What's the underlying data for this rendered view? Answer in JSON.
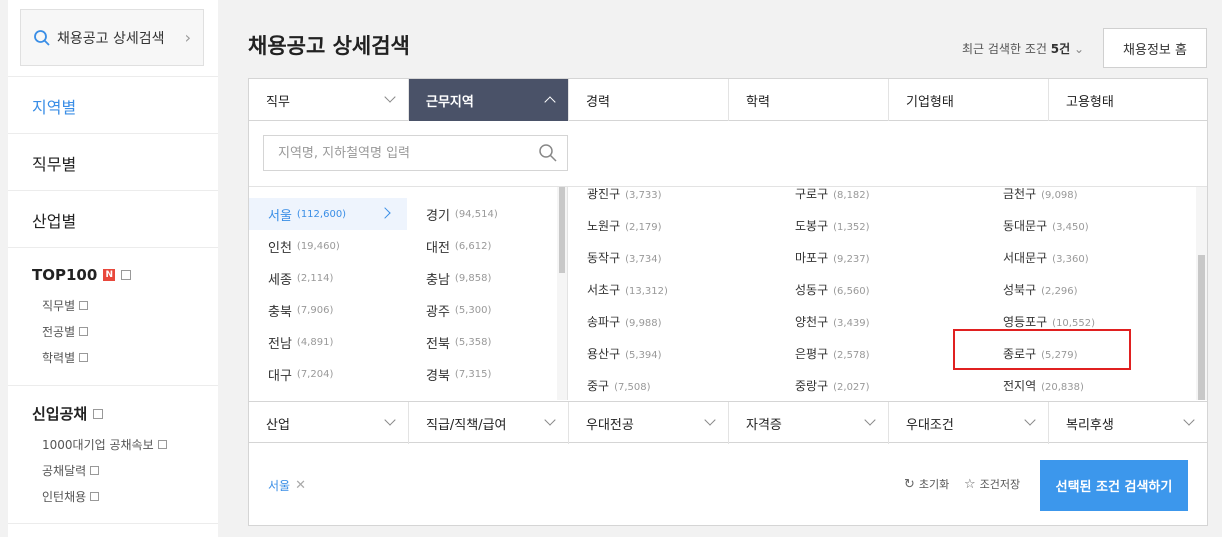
{
  "sidebar": {
    "search_label": "채용공고 상세검색",
    "menus": [
      "지역별",
      "직무별",
      "산업별"
    ],
    "top100": {
      "title": "TOP100",
      "badge": "N",
      "subs": [
        "직무별",
        "전공별",
        "학력별"
      ]
    },
    "newgrad": {
      "title": "신입공채",
      "subs": [
        "1000대기업 공채속보",
        "공채달력",
        "인턴채용"
      ]
    }
  },
  "header": {
    "title": "채용공고 상세검색",
    "recent_prefix": "최근 검색한 조건",
    "recent_count": "5건",
    "home_button": "채용정보 홈"
  },
  "tabs_top": [
    {
      "label": "직무",
      "active": false,
      "arrow": true
    },
    {
      "label": "근무지역",
      "active": true,
      "arrow": true
    },
    {
      "label": "경력",
      "active": false,
      "arrow": false
    },
    {
      "label": "학력",
      "active": false,
      "arrow": false
    },
    {
      "label": "기업형태",
      "active": false,
      "arrow": false
    },
    {
      "label": "고용형태",
      "active": false,
      "arrow": false
    }
  ],
  "region_search": {
    "placeholder": "지역명, 지하철역명 입력"
  },
  "cities_col1": [
    {
      "name": "서울",
      "count": "(112,600)",
      "selected": true
    },
    {
      "name": "인천",
      "count": "(19,460)",
      "selected": false
    },
    {
      "name": "세종",
      "count": "(2,114)",
      "selected": false
    },
    {
      "name": "충북",
      "count": "(7,906)",
      "selected": false
    },
    {
      "name": "전남",
      "count": "(4,891)",
      "selected": false
    },
    {
      "name": "대구",
      "count": "(7,204)",
      "selected": false
    }
  ],
  "cities_col2": [
    {
      "name": "경기",
      "count": "(94,514)"
    },
    {
      "name": "대전",
      "count": "(6,612)"
    },
    {
      "name": "충남",
      "count": "(9,858)"
    },
    {
      "name": "광주",
      "count": "(5,300)"
    },
    {
      "name": "전북",
      "count": "(5,358)"
    },
    {
      "name": "경북",
      "count": "(7,315)"
    }
  ],
  "districts": [
    [
      {
        "name": "광진구",
        "count": "(3,733)"
      },
      {
        "name": "구로구",
        "count": "(8,182)"
      },
      {
        "name": "금천구",
        "count": "(9,098)"
      }
    ],
    [
      {
        "name": "노원구",
        "count": "(2,179)"
      },
      {
        "name": "도봉구",
        "count": "(1,352)"
      },
      {
        "name": "동대문구",
        "count": "(3,450)"
      }
    ],
    [
      {
        "name": "동작구",
        "count": "(3,734)"
      },
      {
        "name": "마포구",
        "count": "(9,237)"
      },
      {
        "name": "서대문구",
        "count": "(3,360)"
      }
    ],
    [
      {
        "name": "서초구",
        "count": "(13,312)"
      },
      {
        "name": "성동구",
        "count": "(6,560)"
      },
      {
        "name": "성북구",
        "count": "(2,296)"
      }
    ],
    [
      {
        "name": "송파구",
        "count": "(9,988)"
      },
      {
        "name": "양천구",
        "count": "(3,439)"
      },
      {
        "name": "영등포구",
        "count": "(10,552)"
      }
    ],
    [
      {
        "name": "용산구",
        "count": "(5,394)"
      },
      {
        "name": "은평구",
        "count": "(2,578)"
      },
      {
        "name": "종로구",
        "count": "(5,279)"
      }
    ],
    [
      {
        "name": "중구",
        "count": "(7,508)"
      },
      {
        "name": "중랑구",
        "count": "(2,027)"
      },
      {
        "name": "전지역",
        "count": "(20,838)"
      }
    ]
  ],
  "tabs_bottom": [
    "산업",
    "직급/직책/급여",
    "우대전공",
    "자격증",
    "우대조건",
    "복리후생"
  ],
  "footer": {
    "selected_chip": "서울",
    "reset_label": "초기화",
    "save_label": "조건저장",
    "search_button": "선택된 조건 검색하기"
  },
  "colors": {
    "accent": "#3a8ee6",
    "active_tab": "#4a5268",
    "search_button": "#3c97ec",
    "highlight": "#e02020"
  }
}
